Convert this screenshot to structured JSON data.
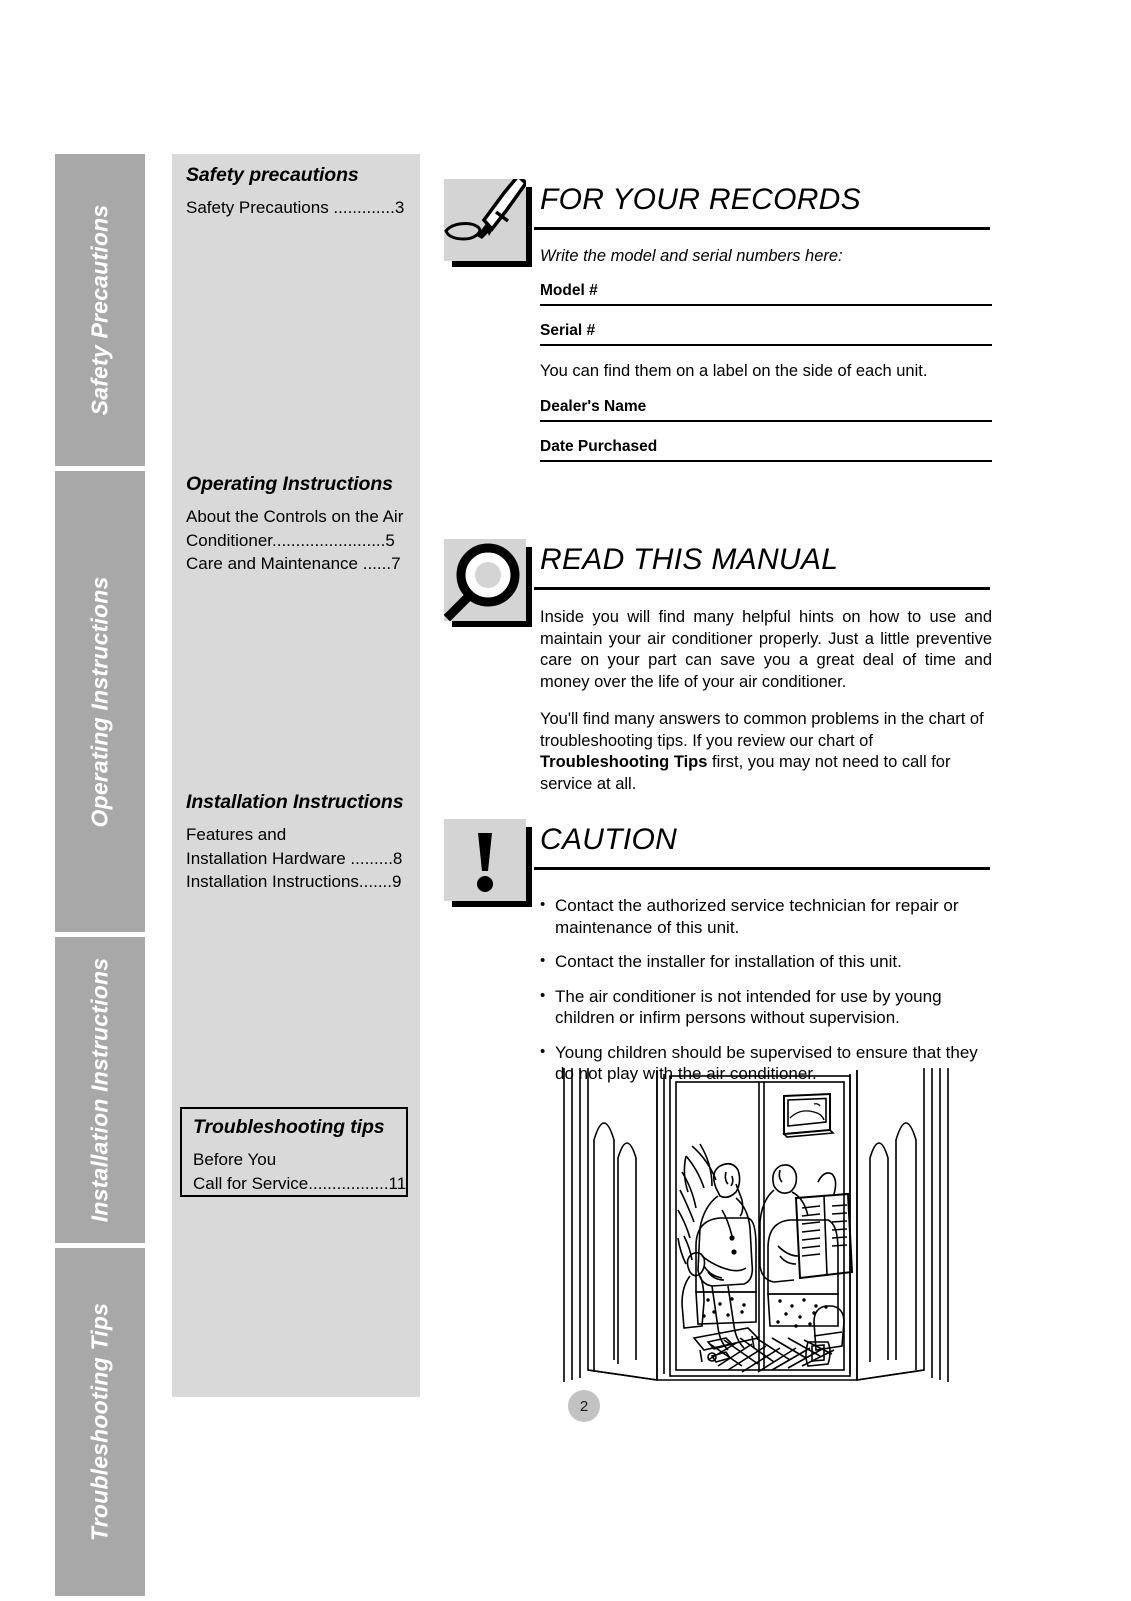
{
  "sidebar": {
    "tabs": [
      {
        "label": "Safety Precautions",
        "icon": "tab-marker"
      },
      {
        "label": "Operating Instructions",
        "icon": "tab-marker"
      },
      {
        "label": "Installation Instructions",
        "icon": "tab-marker"
      },
      {
        "label": "Troubleshooting Tips",
        "icon": "tab-marker"
      }
    ]
  },
  "toc": {
    "groups": [
      {
        "title": "Safety precautions",
        "entries": [
          {
            "text": "Safety Precautions .............3"
          }
        ]
      },
      {
        "title": "Operating Instructions",
        "entries": [
          {
            "text": "About the Controls on the Air"
          },
          {
            "text": "Conditioner........................5"
          },
          {
            "text": "Care and Maintenance ......7"
          }
        ]
      },
      {
        "title": "Installation Instructions",
        "entries": [
          {
            "text": "Features and"
          },
          {
            "text": "Installation Hardware .........8"
          },
          {
            "text": "Installation Instructions.......9"
          }
        ]
      }
    ],
    "boxed_group": {
      "title": "Troubleshooting tips",
      "entries": [
        {
          "text": "Before You"
        },
        {
          "text": "Call for Service.................11"
        }
      ]
    }
  },
  "sections": {
    "records": {
      "icon": "pen-writing-icon",
      "title": "FOR YOUR RECORDS",
      "intro": "Write the model and serial numbers here:",
      "fields": [
        {
          "label": "Model #",
          "value": ""
        },
        {
          "label": "Serial #",
          "value": ""
        }
      ],
      "note": "You can find them on a label on the side of each unit.",
      "fields2": [
        {
          "label": "Dealer's Name",
          "value": ""
        },
        {
          "label": "Date Purchased",
          "value": ""
        }
      ]
    },
    "read_manual": {
      "icon": "magnifier-icon",
      "title": "READ THIS MANUAL",
      "paragraph1": "Inside you will find many helpful hints on how to use and maintain your air conditioner properly. Just a little preventive care on your part can save you a great deal of time and money over the life of your air conditioner.",
      "paragraph2_part1": "You'll find many answers to common problems in the chart of troubleshooting tips. If you review our chart of ",
      "paragraph2_bold": "Troubleshooting Tips",
      "paragraph2_part2": " first, you may not need to call for service at all."
    },
    "caution": {
      "icon": "exclamation-icon",
      "title": "CAUTION",
      "bullets": [
        "Contact the authorized service technician for repair or maintenance of this unit.",
        "Contact the installer for installation of this unit.",
        "The air conditioner is not intended for use by young children or infirm persons without supervision.",
        "Young children should be supervised to ensure that they do not play with the air conditioner."
      ]
    }
  },
  "illustration": {
    "icon": "room-with-air-conditioner-illustration",
    "description": "Line drawing of a living room seen through curtains: two people on a sofa reading a newspaper, a potted plant, and a wall-mounted air conditioner unit."
  },
  "footer": {
    "page_number": "2"
  },
  "colors": {
    "tab_gray": "#a8a8a8",
    "panel_gray": "#d9d9d9",
    "icon_box_gray": "#d4d4d4",
    "page_badge_gray": "#c2c2c2",
    "text": "#000000",
    "tab_text": "#ffffff"
  }
}
